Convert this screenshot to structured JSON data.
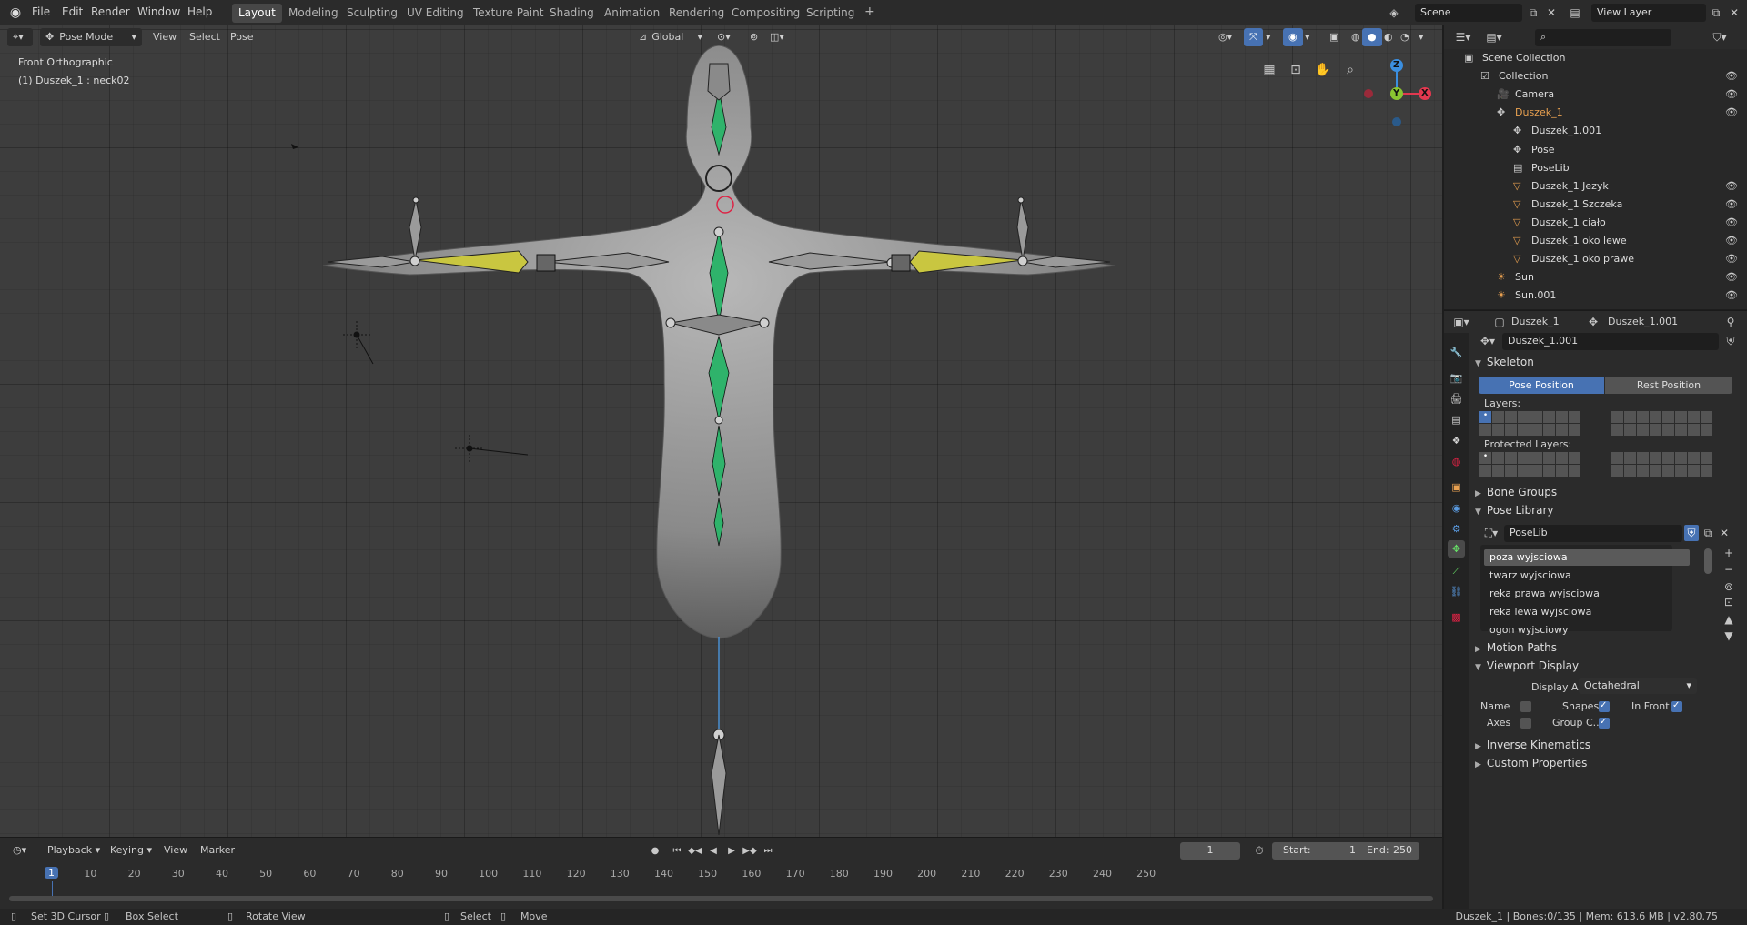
{
  "topbar": {
    "menus": [
      "File",
      "Edit",
      "Render",
      "Window",
      "Help"
    ],
    "workspaces": [
      "Layout",
      "Modeling",
      "Sculpting",
      "UV Editing",
      "Texture Paint",
      "Shading",
      "Animation",
      "Rendering",
      "Compositing",
      "Scripting"
    ],
    "active_workspace": "Layout",
    "add_tab": "+",
    "scene_name": "Scene",
    "view_layer": "View Layer"
  },
  "viewport": {
    "mode": "Pose Mode",
    "menus": [
      "View",
      "Select",
      "Pose"
    ],
    "orientation": "Global",
    "view_name": "Front Orthographic",
    "active_info": "(1) Duszek_1 : neck02",
    "gizmo": {
      "z": "Z",
      "y": "Y",
      "x": "X"
    }
  },
  "outliner": {
    "search_placeholder": "",
    "rows": [
      {
        "label": "Scene Collection",
        "indent": 0
      },
      {
        "label": "Collection",
        "indent": 1
      },
      {
        "label": "Camera",
        "indent": 2
      },
      {
        "label": "Duszek_1",
        "indent": 2,
        "highlight": true
      },
      {
        "label": "Duszek_1.001",
        "indent": 3
      },
      {
        "label": "Pose",
        "indent": 3
      },
      {
        "label": "PoseLib",
        "indent": 3
      },
      {
        "label": "Duszek_1 Jezyk",
        "indent": 3
      },
      {
        "label": "Duszek_1 Szczeka",
        "indent": 3
      },
      {
        "label": "Duszek_1 ciało",
        "indent": 3
      },
      {
        "label": "Duszek_1 oko lewe",
        "indent": 3
      },
      {
        "label": "Duszek_1 oko prawe",
        "indent": 3
      },
      {
        "label": "Sun",
        "indent": 2
      },
      {
        "label": "Sun.001",
        "indent": 2
      }
    ]
  },
  "properties": {
    "object_name": "Duszek_1",
    "armature_name": "Duszek_1.001",
    "data_name": "Duszek_1.001",
    "skeleton": {
      "title": "Skeleton",
      "pose_position": "Pose Position",
      "rest_position": "Rest Position",
      "layers_label": "Layers:",
      "protected_label": "Protected Layers:"
    },
    "bone_groups": "Bone Groups",
    "pose_library": {
      "title": "Pose Library",
      "lib_name": "PoseLib",
      "poses": [
        "poza wyjsciowa",
        "twarz wyjsciowa",
        "reka prawa wyjsciowa",
        "reka lewa wyjsciowa",
        "ogon wyjsciowy"
      ],
      "selected_pose": "poza wyjsciowa"
    },
    "motion_paths": "Motion Paths",
    "viewport_display": {
      "title": "Viewport Display",
      "display_as_label": "Display As",
      "display_as_value": "Octahedral",
      "name_label": "Name",
      "shapes_label": "Shapes",
      "in_front_label": "In Front",
      "axes_label": "Axes",
      "group_colors_label": "Group C.."
    },
    "inverse_kinematics": "Inverse Kinematics",
    "custom_properties": "Custom Properties"
  },
  "timeline": {
    "menus": [
      "Playback",
      "Keying",
      "View",
      "Marker"
    ],
    "current_frame": "1",
    "start_label": "Start:",
    "start_value": "1",
    "end_label": "End:",
    "end_value": "250",
    "ruler_ticks": [
      "1",
      "10",
      "20",
      "30",
      "40",
      "50",
      "60",
      "70",
      "80",
      "90",
      "100",
      "110",
      "120",
      "130",
      "140",
      "150",
      "160",
      "170",
      "180",
      "190",
      "200",
      "210",
      "220",
      "230",
      "240",
      "250"
    ]
  },
  "statusbar": {
    "set_cursor": "Set 3D Cursor",
    "box_select": "Box Select",
    "rotate_view": "Rotate View",
    "select": "Select",
    "move": "Move",
    "stats": "Duszek_1 | Bones:0/135 | Mem: 613.6 MB | v2.80.75"
  },
  "colors": {
    "accent": "#4772b3",
    "selected_object": "#e8a050",
    "bone_green": "#2fb36b",
    "bone_yellow": "#c9c640",
    "x_axis": "#e2384f",
    "y_axis": "#8ac531",
    "z_axis": "#3b8fe0"
  }
}
